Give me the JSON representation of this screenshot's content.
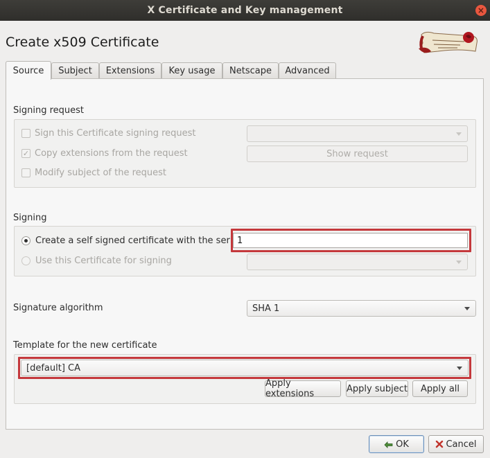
{
  "window": {
    "title": "X Certificate and Key management",
    "close_icon": "×"
  },
  "page": {
    "heading": "Create x509 Certificate"
  },
  "tabs": [
    {
      "label": "Source"
    },
    {
      "label": "Subject"
    },
    {
      "label": "Extensions"
    },
    {
      "label": "Key usage"
    },
    {
      "label": "Netscape"
    },
    {
      "label": "Advanced"
    }
  ],
  "signing_request": {
    "label": "Signing request",
    "sign_csr": {
      "label": "Sign this Certificate signing request",
      "checked": false
    },
    "copy_ext": {
      "label": "Copy extensions from the request",
      "checked": true
    },
    "modify_subject": {
      "label": "Modify subject of the request",
      "checked": false
    },
    "request_combo_value": "",
    "show_request_label": "Show request"
  },
  "signing": {
    "label": "Signing",
    "self_signed": {
      "label": "Create a self signed certificate with the serial",
      "selected": true
    },
    "serial_value": "1",
    "use_ca": {
      "label": "Use this Certificate for signing",
      "selected": false
    },
    "ca_combo_value": ""
  },
  "signature": {
    "label": "Signature algorithm",
    "value": "SHA 1"
  },
  "template": {
    "label": "Template for the new certificate",
    "value": "[default] CA",
    "apply_extensions": "Apply extensions",
    "apply_subject": "Apply subject",
    "apply_all": "Apply all"
  },
  "footer": {
    "ok_label": "OK",
    "cancel_label": "Cancel"
  },
  "colors": {
    "highlight": "#c4383c",
    "titlebar": "#3e3d39"
  }
}
